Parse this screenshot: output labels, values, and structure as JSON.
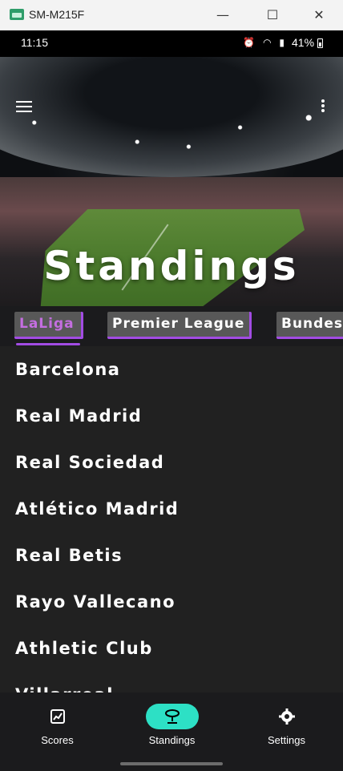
{
  "window": {
    "title": "SM-M215F",
    "minimize": "—",
    "maximize": "☐",
    "close": "✕"
  },
  "status_bar": {
    "time": "11:15",
    "icons": [
      "alarm-icon",
      "wifi-icon",
      "call-icon",
      "signal-icon",
      "volte-icon",
      "signal-icon"
    ],
    "battery": "41%"
  },
  "header": {
    "title": "Standings"
  },
  "tabs": [
    {
      "label": "LaLiga",
      "active": true
    },
    {
      "label": "Premier League",
      "active": false
    },
    {
      "label": "Bundes",
      "active": false
    }
  ],
  "teams": [
    "Barcelona",
    "Real Madrid",
    "Real Sociedad",
    "Atlético Madrid",
    "Real Betis",
    "Rayo Vallecano",
    "Athletic Club",
    "Villarreal"
  ],
  "bottom_nav": [
    {
      "label": "Scores",
      "icon": "scores-icon",
      "active": false
    },
    {
      "label": "Standings",
      "icon": "standings-icon",
      "active": true
    },
    {
      "label": "Settings",
      "icon": "gear-icon",
      "active": false
    }
  ],
  "colors": {
    "accent": "#a24ce3",
    "active_nav": "#2de0c5",
    "list_bg": "#212121"
  }
}
